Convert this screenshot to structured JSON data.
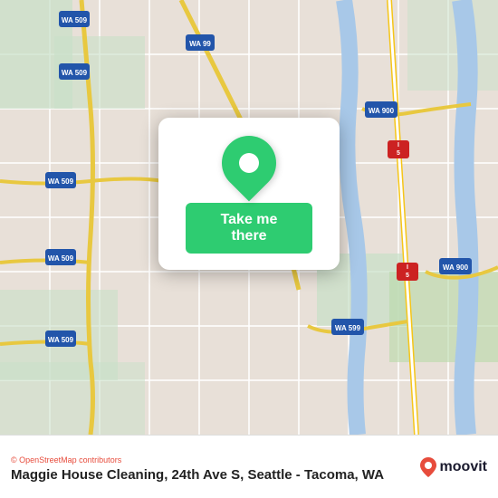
{
  "map": {
    "attribution": "© OpenStreetMap contributors",
    "background_color": "#e8e0d8"
  },
  "card": {
    "pin_label": "Location pin",
    "button_label": "Take me there"
  },
  "bottom_bar": {
    "location_name": "Maggie House Cleaning, 24th Ave S, Seattle - Tacoma, WA",
    "moovit_label": "moovit",
    "attribution": "© OpenStreetMap contributors"
  }
}
